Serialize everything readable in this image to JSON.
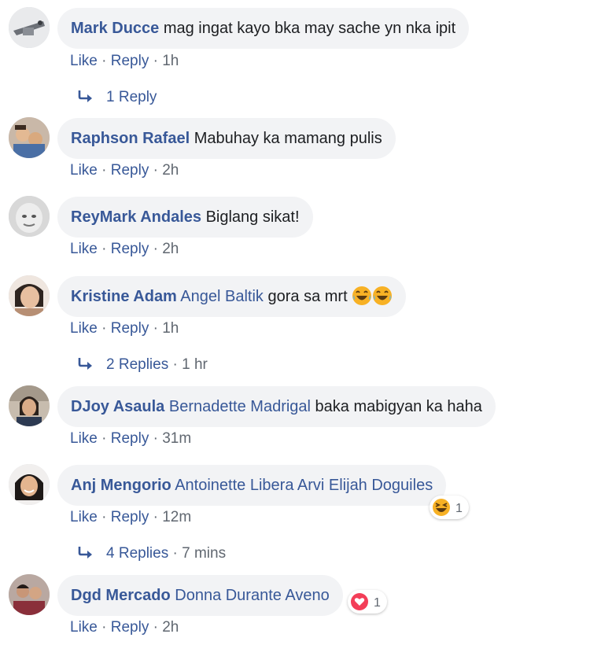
{
  "comments": [
    {
      "author": "Mark Ducce",
      "tag": "",
      "text": "mag ingat kayo bka may sache yn nka ipit",
      "like": "Like",
      "reply": "Reply",
      "time": "1h"
    },
    {
      "author": "Raphson Rafael",
      "tag": "",
      "text": "Mabuhay ka mamang pulis",
      "like": "Like",
      "reply": "Reply",
      "time": "2h"
    },
    {
      "author": "ReyMark Andales",
      "tag": "",
      "text": "Biglang sikat!",
      "like": "Like",
      "reply": "Reply",
      "time": "2h"
    },
    {
      "author": "Kristine Adam",
      "tag": "Angel Baltik",
      "text": "gora sa mrt",
      "like": "Like",
      "reply": "Reply",
      "time": "1h"
    },
    {
      "author": "DJoy Asaula",
      "tag": "Bernadette Madrigal",
      "text": "baka mabigyan ka haha",
      "like": "Like",
      "reply": "Reply",
      "time": "31m"
    },
    {
      "author": "Anj Mengorio",
      "tag": "Antoinette Libera Arvi Elijah Doguiles",
      "text": "",
      "like": "Like",
      "reply": "Reply",
      "time": "12m",
      "reaction_count": "1"
    },
    {
      "author": "Dgd Mercado",
      "tag": "Donna Durante Aveno",
      "text": "",
      "like": "Like",
      "reply": "Reply",
      "time": "2h",
      "reaction_count": "1"
    }
  ],
  "reply_threads": [
    {
      "label": "1 Reply",
      "time": ""
    },
    {
      "label": "2 Replies",
      "time": "1 hr"
    },
    {
      "label": "4 Replies",
      "time": "7 mins"
    }
  ],
  "separator": " · ",
  "colors": {
    "link": "#385898",
    "meta": "#606770",
    "bubble": "#f2f3f5",
    "text": "#1c1e21",
    "heart": "#f33e58",
    "emoji": "#f7b125"
  },
  "icons": [
    "reply-arrow-icon",
    "laughing-emoji-icon",
    "haha-reaction-icon",
    "love-reaction-icon"
  ]
}
